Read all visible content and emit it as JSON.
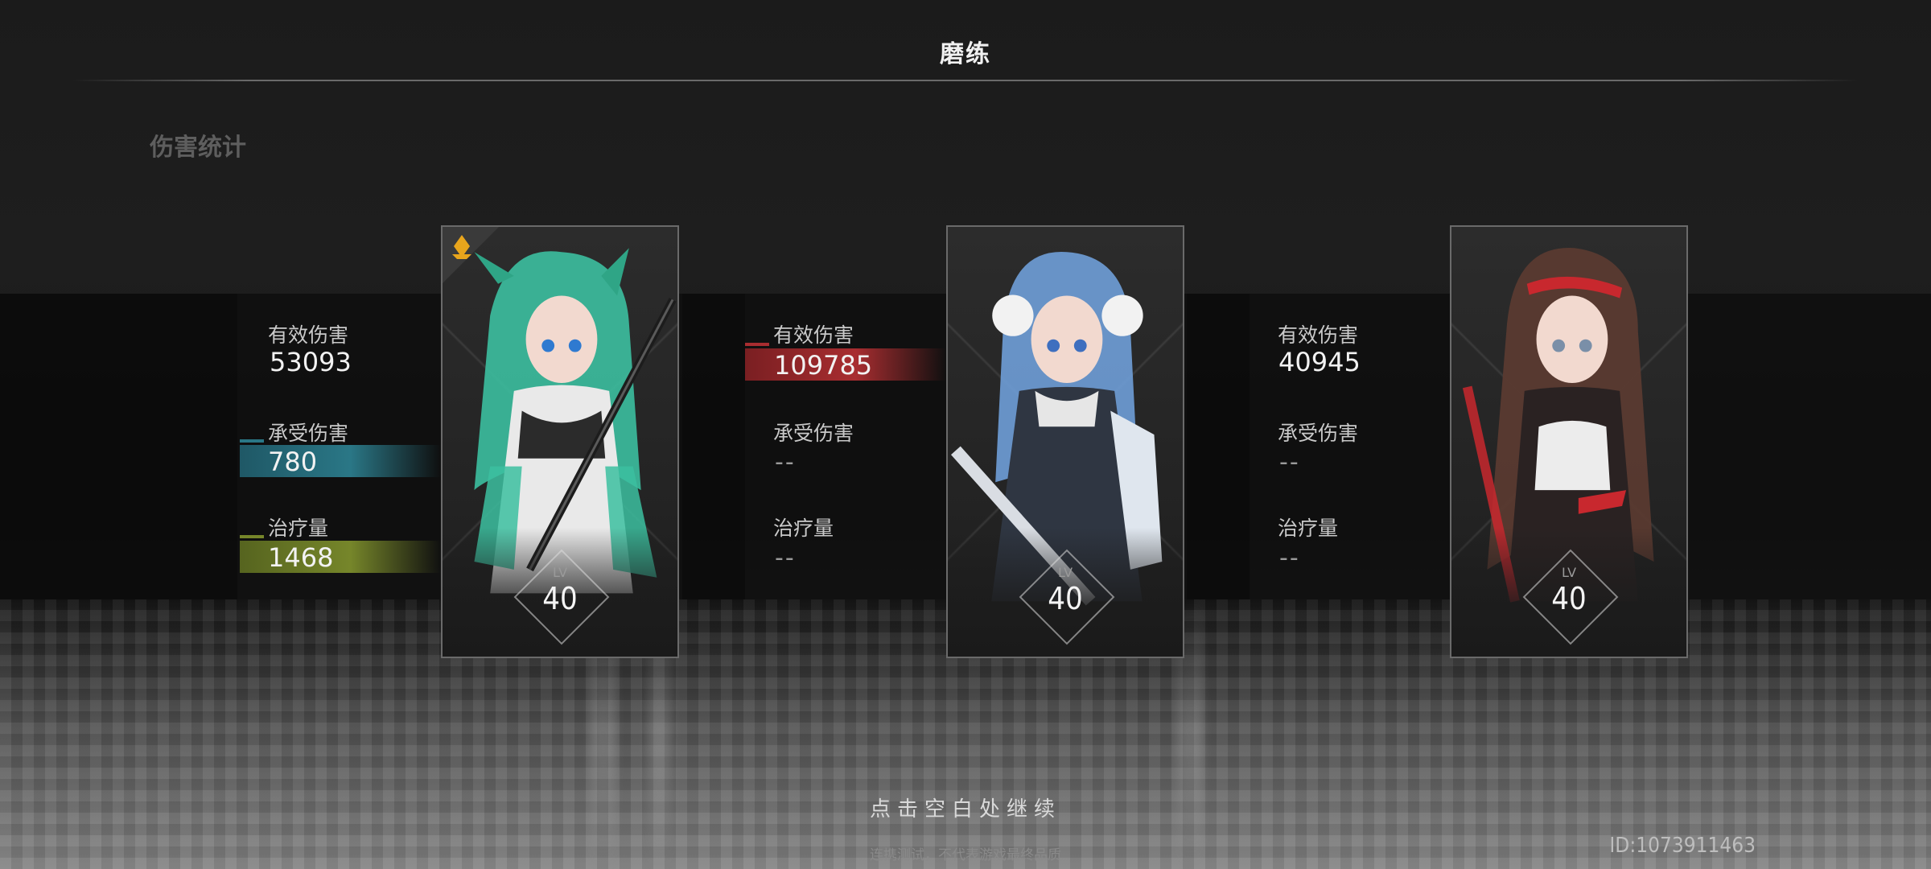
{
  "header": {
    "title": "磨练",
    "section_title": "伤害统计"
  },
  "characters": [
    {
      "stats": [
        {
          "label": "有效伤害",
          "value": "53093",
          "highlight": "none"
        },
        {
          "label": "承受伤害",
          "value": "780",
          "highlight": "teal"
        },
        {
          "label": "治疗量",
          "value": "1468",
          "highlight": "olive"
        }
      ],
      "lv_label": "LV",
      "level": "40",
      "leader": true,
      "hair_color": "#3cbfa0"
    },
    {
      "stats": [
        {
          "label": "有效伤害",
          "value": "109785",
          "highlight": "red"
        },
        {
          "label": "承受伤害",
          "value": "--",
          "highlight": "none"
        },
        {
          "label": "治疗量",
          "value": "--",
          "highlight": "none"
        }
      ],
      "lv_label": "LV",
      "level": "40",
      "leader": false,
      "hair_color": "#6f9fd8"
    },
    {
      "stats": [
        {
          "label": "有效伤害",
          "value": "40945",
          "highlight": "none"
        },
        {
          "label": "承受伤害",
          "value": "--",
          "highlight": "none"
        },
        {
          "label": "治疗量",
          "value": "--",
          "highlight": "none"
        }
      ],
      "lv_label": "LV",
      "level": "40",
      "leader": false,
      "hair_color": "#5a3a30"
    }
  ],
  "footer": {
    "continue_hint": "点击空白处继续",
    "disclaimer": "连携测试，不代表游戏最终品质",
    "player_id": "ID:1073911463"
  },
  "colors": {
    "teal": "#2a7786",
    "olive": "#76862a",
    "red": "#a82d30",
    "leader_badge": "#e8a51c"
  }
}
